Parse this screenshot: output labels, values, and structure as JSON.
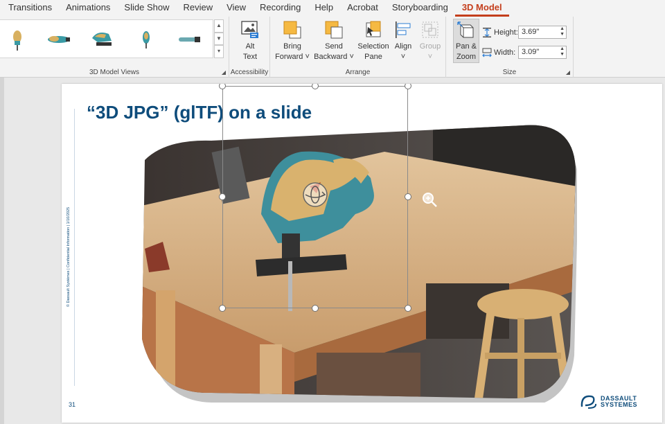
{
  "tabs": [
    {
      "label": "Transitions",
      "active": false
    },
    {
      "label": "Animations",
      "active": false
    },
    {
      "label": "Slide Show",
      "active": false
    },
    {
      "label": "Review",
      "active": false
    },
    {
      "label": "View",
      "active": false
    },
    {
      "label": "Recording",
      "active": false
    },
    {
      "label": "Help",
      "active": false
    },
    {
      "label": "Acrobat",
      "active": false
    },
    {
      "label": "Storyboarding",
      "active": false
    },
    {
      "label": "3D Model",
      "active": true
    }
  ],
  "ribbon": {
    "views_group": {
      "label": "3D Model Views",
      "thumbnail_count": 5
    },
    "accessibility_group": {
      "label": "Accessibility",
      "alt_text": {
        "line1": "Alt",
        "line2": "Text"
      }
    },
    "arrange_group": {
      "label": "Arrange",
      "bring_forward": {
        "line1": "Bring",
        "line2": "Forward ˅"
      },
      "send_backward": {
        "line1": "Send",
        "line2": "Backward ˅"
      },
      "selection_pane": {
        "line1": "Selection",
        "line2": "Pane"
      },
      "align": {
        "line1": "Align",
        "line2": "˅"
      },
      "group": {
        "line1": "Group",
        "line2": "˅",
        "disabled": true
      }
    },
    "size_group": {
      "label": "Size",
      "pan_zoom": {
        "line1": "Pan &",
        "line2": "Zoom",
        "pressed": true
      },
      "height": {
        "label": "Height:",
        "value": "3.69\""
      },
      "width": {
        "label": "Width:",
        "value": "3.09\""
      }
    }
  },
  "slide": {
    "title": "“3D JPG” (glTF) on a slide",
    "confidential": "© Dassault Systèmes | Confidential Information | 1/10/2025",
    "number": "31",
    "brand_line1": "DASSAULT",
    "brand_line2": "SYSTEMES"
  },
  "colors": {
    "accent": "#c43e1c",
    "title": "#0e4c7b",
    "ribbon_bg": "#f3f3f3"
  }
}
